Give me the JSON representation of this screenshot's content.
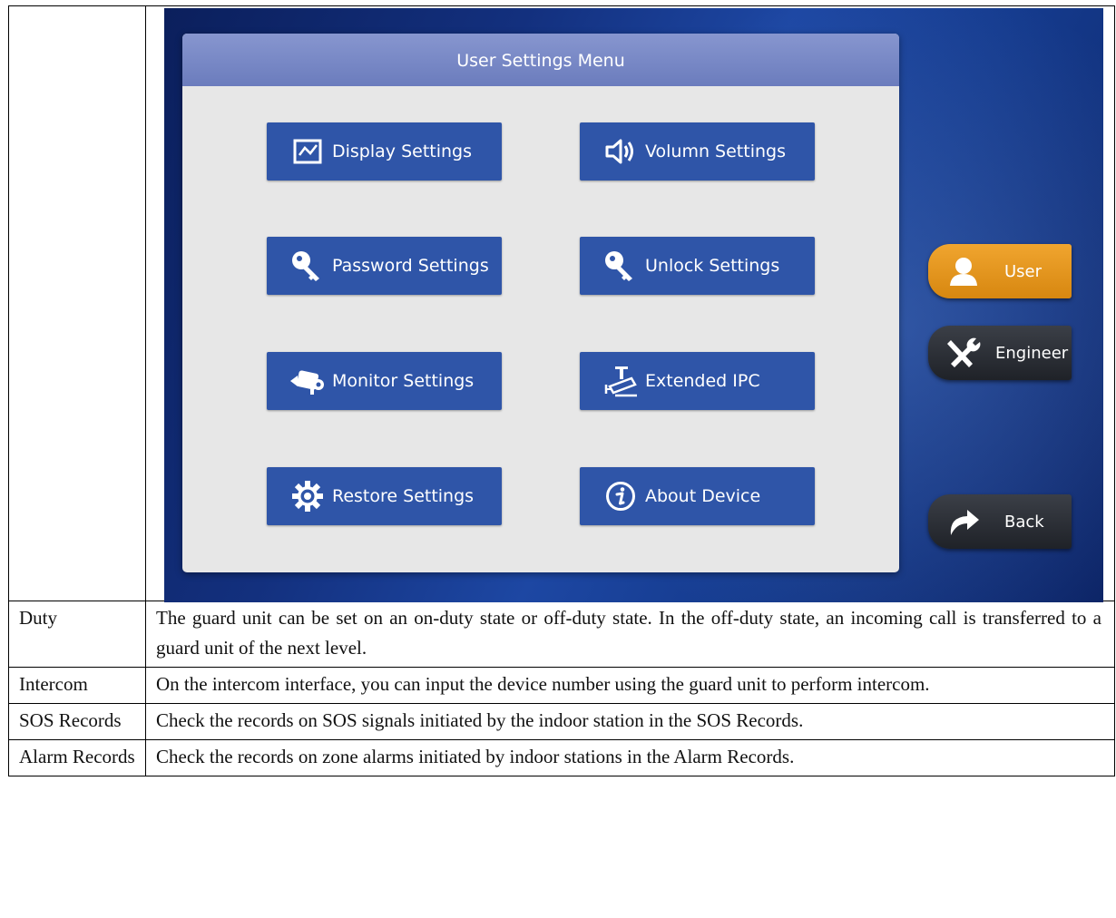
{
  "screen": {
    "dialog_title": "User Settings Menu",
    "menu": [
      {
        "label": "Display Settings",
        "icon": "display-icon"
      },
      {
        "label": "Volumn Settings",
        "icon": "speaker-icon"
      },
      {
        "label": "Password Settings",
        "icon": "key-icon"
      },
      {
        "label": "Unlock Settings",
        "icon": "key-icon"
      },
      {
        "label": "Monitor Settings",
        "icon": "camera-icon"
      },
      {
        "label": "Extended IPC",
        "icon": "ipc-camera-icon"
      },
      {
        "label": "Restore Settings",
        "icon": "gear-icon"
      },
      {
        "label": "About Device",
        "icon": "info-icon"
      }
    ],
    "side": {
      "user": "User",
      "engineer": "Engineer",
      "back": "Back"
    },
    "colors": {
      "menu_button": "#2f55a8",
      "dialog_bg": "#e7e7e7",
      "header_bg": "#7b8bc8",
      "user_button": "#e89a22",
      "dark_button": "#2a2d33",
      "screen_bg": "#153b8e"
    }
  },
  "table": {
    "rows": [
      {
        "label": "Duty",
        "desc": "The guard unit can be set on an on-duty state or off-duty state. In the off-duty state, an incoming call is transferred to a guard unit of the next level."
      },
      {
        "label": "Intercom",
        "desc": "On the intercom interface, you can input the device number using the guard unit to perform intercom."
      },
      {
        "label": "SOS Records",
        "desc": "Check the records on SOS signals initiated by the indoor station in the SOS Records."
      },
      {
        "label": "Alarm Records",
        "desc": "Check the records on zone alarms initiated by indoor stations in the Alarm Records."
      }
    ]
  }
}
